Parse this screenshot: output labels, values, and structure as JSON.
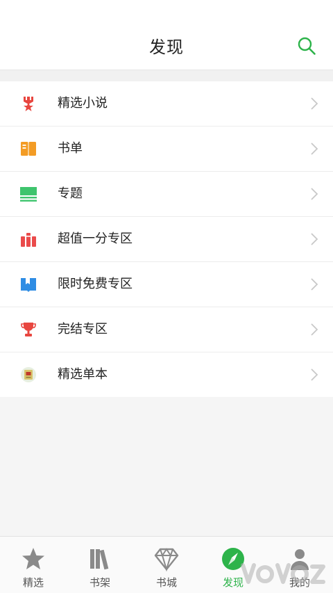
{
  "header": {
    "title": "发现"
  },
  "menu": {
    "items": [
      {
        "label": "精选小说",
        "icon": "ribbon-star-icon",
        "color": "#e8463f"
      },
      {
        "label": "书单",
        "icon": "open-book-icon",
        "color": "#f39c25"
      },
      {
        "label": "专题",
        "icon": "topic-list-icon",
        "color": "#3ec46d"
      },
      {
        "label": "超值一分专区",
        "icon": "books-stack-icon",
        "color": "#ea4b4b"
      },
      {
        "label": "限时免费专区",
        "icon": "bookmark-book-icon",
        "color": "#2f8de4"
      },
      {
        "label": "完结专区",
        "icon": "trophy-icon",
        "color": "#e8463f"
      },
      {
        "label": "精选单本",
        "icon": "single-book-icon",
        "color": "#c9b35a"
      }
    ]
  },
  "tabbar": {
    "tabs": [
      {
        "label": "精选",
        "icon": "star-icon",
        "active": false
      },
      {
        "label": "书架",
        "icon": "bookshelf-icon",
        "active": false
      },
      {
        "label": "书城",
        "icon": "diamond-icon",
        "active": false
      },
      {
        "label": "发现",
        "icon": "compass-icon",
        "active": true
      },
      {
        "label": "我的",
        "icon": "profile-icon",
        "active": false
      }
    ]
  },
  "colors": {
    "accent": "#2db34a",
    "inactive_tab": "#8a8a8a"
  }
}
